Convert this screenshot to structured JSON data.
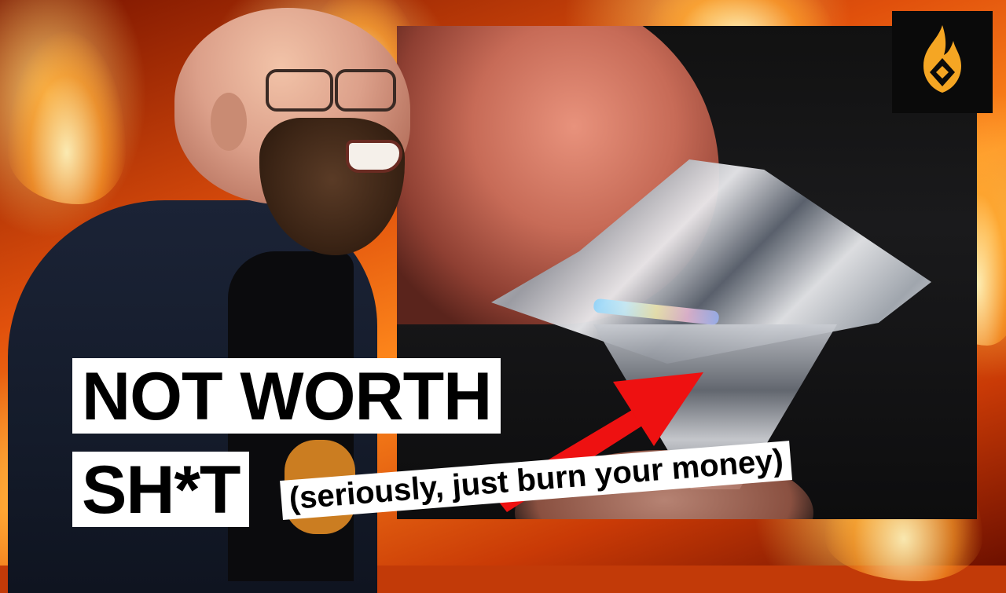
{
  "thumbnail": {
    "headline_line1": "NOT WORTH",
    "headline_line2": "SH*T",
    "subheadline": "(seriously, just burn your money)"
  },
  "colors": {
    "headline_bg": "#ffffff",
    "headline_text": "#000000",
    "arrow": "#ee1111",
    "logo_bg": "#0a0a0a",
    "logo_flame": "#f5a623"
  },
  "icons": {
    "logo": "flame-logo-icon",
    "arrow": "red-arrow"
  }
}
